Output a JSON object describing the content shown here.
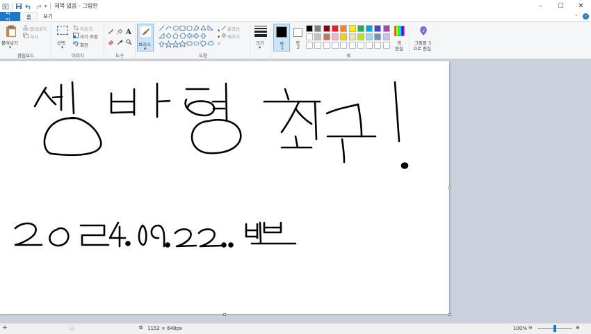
{
  "window": {
    "title": "제목 없음 - 그림판",
    "minimize": "–",
    "maximize": "☐",
    "close": "✕"
  },
  "menu": {
    "file": "파일",
    "home": "홈",
    "view": "보기",
    "help": "?"
  },
  "ribbon": {
    "clipboard": {
      "paste": "붙여넣기",
      "cut": "잘라내기",
      "copy": "복사",
      "group": "클립보드"
    },
    "image": {
      "select": "선택",
      "crop": "자르기",
      "resize": "크기 조정",
      "rotate": "회전",
      "group": "이미지"
    },
    "tools": {
      "group": "도구"
    },
    "brushes": {
      "label": "브러시"
    },
    "shapes": {
      "outline": "윤곽선",
      "fill": "채우기",
      "group": "도형"
    },
    "size": {
      "label": "크기"
    },
    "color1": {
      "label": "색",
      "num": "1"
    },
    "color2": {
      "label": "색",
      "num": "2"
    },
    "colors_group": "색",
    "edit_colors": {
      "line1": "색",
      "line2": "편집"
    },
    "paint3d": {
      "line1": "그림판 3",
      "line2": "D로 편집"
    },
    "palette": [
      "#000000",
      "#7f7f7f",
      "#880015",
      "#ed1c24",
      "#ff7f27",
      "#fff200",
      "#22b14c",
      "#00a2e8",
      "#3f48cc",
      "#a349a4",
      "#ffffff",
      "#c3c3c3",
      "#b97a57",
      "#ffaec9",
      "#ffc90e",
      "#efe4b0",
      "#b5e61d",
      "#99d9ea",
      "#7092be",
      "#c8bfe7",
      "#ffffff",
      "#ffffff",
      "#ffffff",
      "#ffffff",
      "#ffffff",
      "#ffffff",
      "#ffffff",
      "#ffffff",
      "#ffffff",
      "#ffffff"
    ],
    "color1_value": "#000000",
    "color2_value": "#ffffff"
  },
  "status": {
    "image_size": "1152 × 648px",
    "zoom": "100%"
  }
}
